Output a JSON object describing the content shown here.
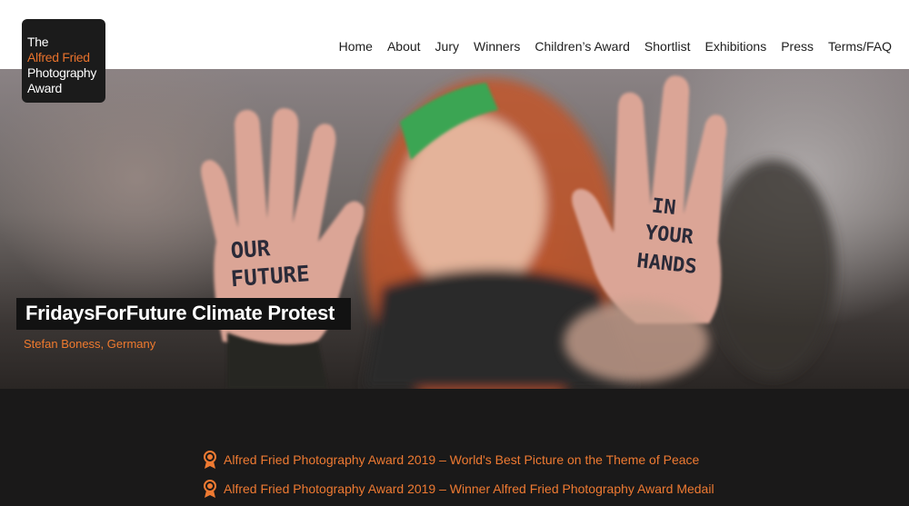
{
  "logo": {
    "line1": "The",
    "line2": "Alfred Fried",
    "line3": "Photography",
    "line4": "Award"
  },
  "nav": {
    "items": [
      "Home",
      "About",
      "Jury",
      "Winners",
      "Children’s Award",
      "Shortlist",
      "Exhibitions",
      "Press",
      "Terms/FAQ"
    ]
  },
  "hero": {
    "left_hand_text": [
      "OUR",
      "FUTURE"
    ],
    "right_hand_text": [
      "IN",
      "YOUR",
      "HANDS"
    ],
    "title": "FridaysForFuture Climate Protest",
    "author": "Stefan Boness, Germany"
  },
  "awards": [
    {
      "icon": "medal-icon",
      "text": "Alfred Fried Photography Award 2019 – World's Best Picture on the Theme of Peace"
    },
    {
      "icon": "medal-icon",
      "text": "Alfred Fried Photography Award 2019 – Winner Alfred Fried Photography Award Medail"
    }
  ],
  "colors": {
    "accent": "#ee7a32",
    "background": "#1a1919",
    "header": "#ffffff"
  }
}
